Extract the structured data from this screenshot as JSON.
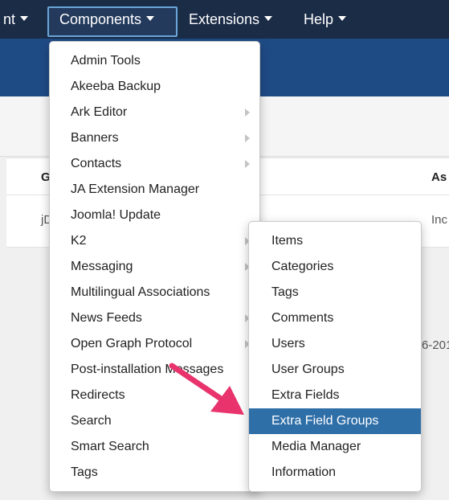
{
  "navbar": {
    "items": [
      {
        "label": "nt"
      },
      {
        "label": "Components"
      },
      {
        "label": "Extensions"
      },
      {
        "label": "Help"
      }
    ]
  },
  "background": {
    "col_g": "G",
    "col_as": "As",
    "cell_j": "jD",
    "cell_inc": "Inc",
    "cell_date": "6-201"
  },
  "components_menu": {
    "items": [
      {
        "label": "Admin Tools",
        "has_submenu": false
      },
      {
        "label": "Akeeba Backup",
        "has_submenu": false
      },
      {
        "label": "Ark Editor",
        "has_submenu": true
      },
      {
        "label": "Banners",
        "has_submenu": true
      },
      {
        "label": "Contacts",
        "has_submenu": true
      },
      {
        "label": "JA Extension Manager",
        "has_submenu": false
      },
      {
        "label": "Joomla! Update",
        "has_submenu": false
      },
      {
        "label": "K2",
        "has_submenu": true
      },
      {
        "label": "Messaging",
        "has_submenu": true
      },
      {
        "label": "Multilingual Associations",
        "has_submenu": false
      },
      {
        "label": "News Feeds",
        "has_submenu": true
      },
      {
        "label": "Open Graph Protocol",
        "has_submenu": true
      },
      {
        "label": "Post-installation Messages",
        "has_submenu": false
      },
      {
        "label": "Redirects",
        "has_submenu": false
      },
      {
        "label": "Search",
        "has_submenu": false
      },
      {
        "label": "Smart Search",
        "has_submenu": false
      },
      {
        "label": "Tags",
        "has_submenu": false
      }
    ]
  },
  "k2_submenu": {
    "items": [
      {
        "label": "Items",
        "active": false
      },
      {
        "label": "Categories",
        "active": false
      },
      {
        "label": "Tags",
        "active": false
      },
      {
        "label": "Comments",
        "active": false
      },
      {
        "label": "Users",
        "active": false
      },
      {
        "label": "User Groups",
        "active": false
      },
      {
        "label": "Extra Fields",
        "active": false
      },
      {
        "label": "Extra Field Groups",
        "active": true
      },
      {
        "label": "Media Manager",
        "active": false
      },
      {
        "label": "Information",
        "active": false
      }
    ]
  },
  "colors": {
    "navbar": "#1b2c47",
    "header": "#1f4b85",
    "highlight": "#2f6fa8",
    "annotation_arrow": "#e8336d"
  },
  "icons": {
    "caret": "caret-down-icon",
    "submenu": "chevron-right-icon",
    "annotation": "pink-arrow-icon"
  }
}
